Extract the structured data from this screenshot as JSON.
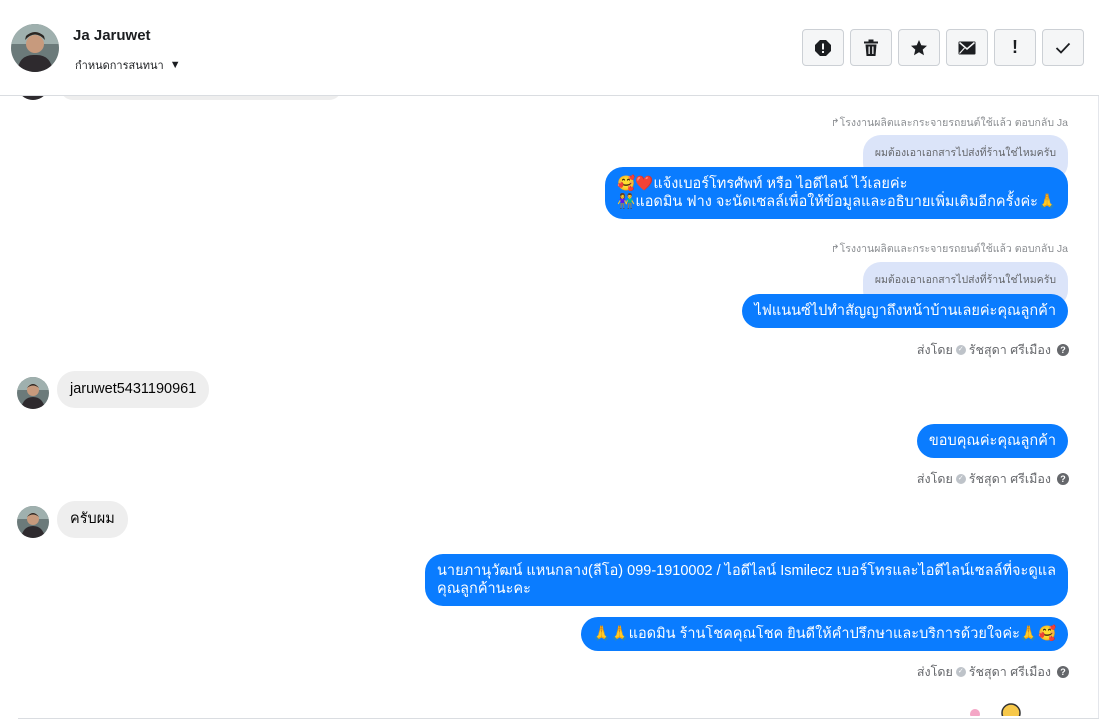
{
  "header": {
    "contact_name": "Ja Jaruwet",
    "conversation_settings": "กำหนดการสนทนา",
    "actions": [
      "spam",
      "delete",
      "star",
      "mark-unread",
      "important",
      "done"
    ],
    "important_label": "!"
  },
  "thread": {
    "reply_note_1": "โรงงานผลิตและกระจายรถยนต์ใช้แล้ว ตอบกลับ Ja",
    "quoted_1": "ผมต้องเอาเอกสารไปส่งที่ร้านใช่ไหมครับ",
    "msg_1_line1": "🥰❤️แจ้งเบอร์โทรศัพท์ หรือ ไอดีไลน์  ไว้เลยค่ะ",
    "msg_1_line2": "👫แอดมิน ฟาง จะนัดเซลล์เพื่อให้ข้อมูลและอธิบายเพิ่มเติมอีกครั้งค่ะ🙏",
    "reply_note_2": "โรงงานผลิตและกระจายรถยนต์ใช้แล้ว ตอบกลับ Ja",
    "quoted_2": "ผมต้องเอาเอกสารไปส่งที่ร้านใช่ไหมครับ",
    "msg_2": "ไฟแนนซ์ไปทำสัญญาถึงหน้าบ้านเลยค่ะคุณลูกค้า",
    "sent_by_prefix": "ส่งโดย",
    "sender": "รัชสุดา ศรีเมือง",
    "incoming_1": "jaruwet5431190961",
    "msg_3": "ขอบคุณค่ะคุณลูกค้า",
    "incoming_2": "ครับผม",
    "msg_4_line1": "นายภานุวัฒน์ แหนกลาง(ลีโอ)       099-1910002 / ไอดีไลน์ Ismilecz   เบอร์โทรและไอดีไลน์เซลล์ที่จะดูแล",
    "msg_4_line2": "คุณลูกค้านะคะ",
    "msg_5": "🙏🙏แอดมิน ร้านโชคคุณโชค ยินดีให้คำปรึกษาและบริการด้วยใจค่ะ🙏🥰"
  },
  "colors": {
    "outgoing_bubble": "#0a7cff",
    "incoming_bubble": "#eeeeee",
    "quoted_bubble": "#dbe4f9"
  }
}
